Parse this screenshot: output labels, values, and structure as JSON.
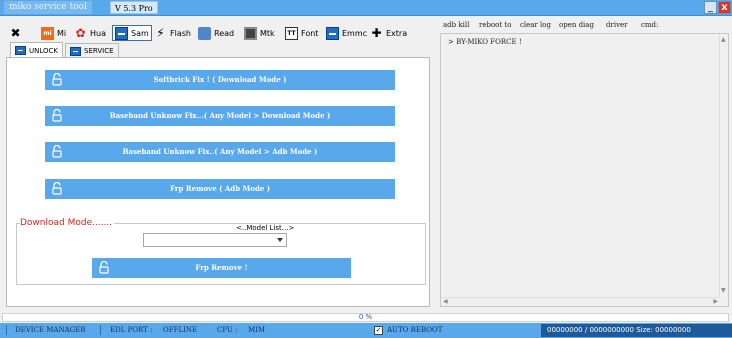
{
  "window": {
    "title": "miko service tool",
    "version": "V 5.3 Pro",
    "minimize": "_",
    "close": "x"
  },
  "tool_tabs": [
    {
      "label": "",
      "icon": "tools-icon"
    },
    {
      "label": "Mi",
      "icon": "mi-icon"
    },
    {
      "label": "Hua",
      "icon": "huawei-icon"
    },
    {
      "label": "Sam",
      "icon": "samsung-icon"
    },
    {
      "label": "Flash",
      "icon": "flash-icon"
    },
    {
      "label": "Read",
      "icon": "read-icon"
    },
    {
      "label": "Mtk",
      "icon": "chip-icon"
    },
    {
      "label": "Font",
      "icon": "font-icon"
    },
    {
      "label": "Emmc",
      "icon": "emmc-icon"
    },
    {
      "label": "Extra",
      "icon": "extra-icon"
    }
  ],
  "sub_tabs": [
    {
      "label": "UNLOCK"
    },
    {
      "label": "SERVICE"
    }
  ],
  "actions": [
    "Softbrick Fix ! ( Download Mode )",
    "Baseband Unknow Fix...( Any Model > Download Mode )",
    "Baseband Unknow Fix..( Any Model > Adb Mode  )",
    "Frp Remove ( Adb Mode )"
  ],
  "download_mode": {
    "label": "Download Mode.......",
    "model_label": "<..Model List...>",
    "model_value": "",
    "frp_button": "Frp Remove !"
  },
  "right_menu": [
    "adb kill",
    "reboot to",
    "clear log",
    "open diag",
    "driver",
    "cmd:"
  ],
  "log": {
    "line": "> BY-MIKO FORCE !"
  },
  "progress": {
    "value": 0,
    "text": "0  %"
  },
  "status": {
    "device_manager": "DEVICE MANAGER",
    "edl_port_label": "EDL PORT  :",
    "edl_port_value": "OFFLINE",
    "cpu_label": "CPU  :",
    "cpu_value": "MIM",
    "auto_reboot_label": "AUTO REBOOT",
    "auto_reboot_checked": true,
    "size_text": "00000000 / 0000000000 Size: 00000000"
  },
  "colors": {
    "accent": "#5aa8ec",
    "button_text": "#ffffff",
    "download_label": "#e02020",
    "close_button": "#d9342b"
  }
}
